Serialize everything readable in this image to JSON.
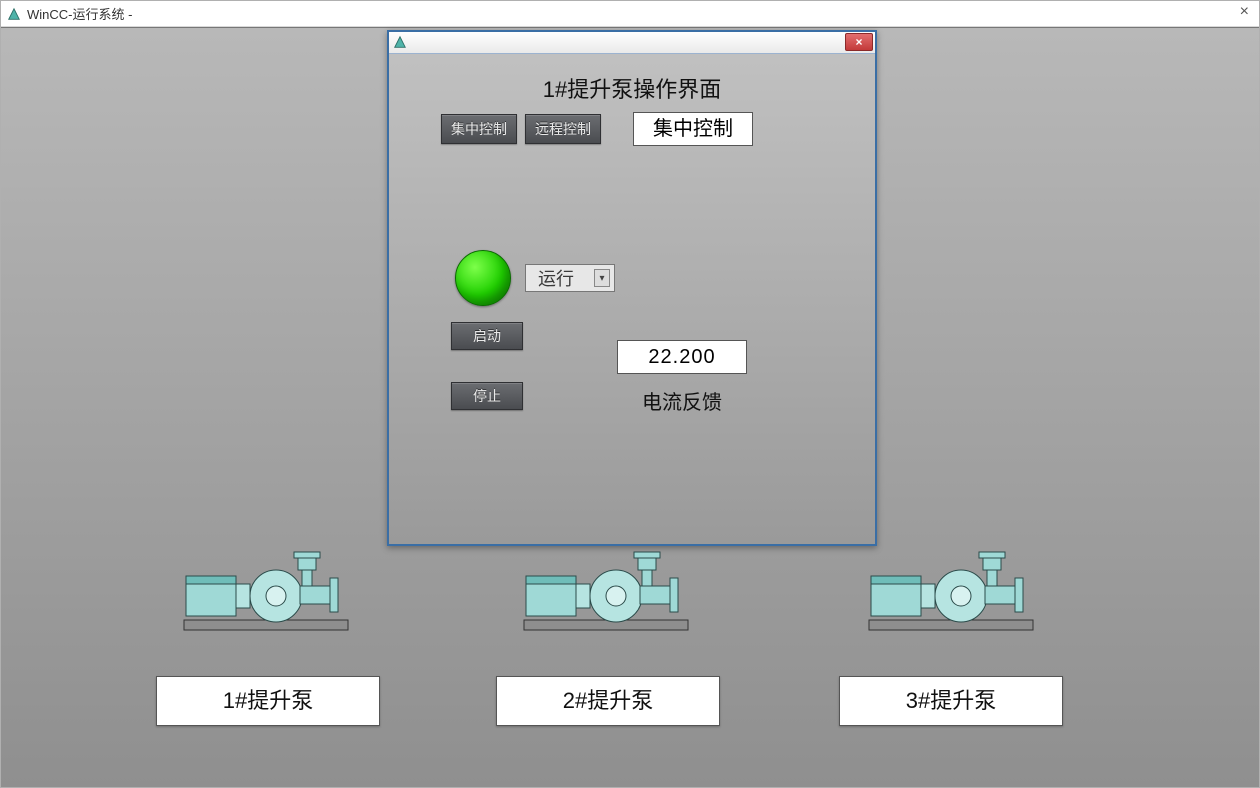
{
  "window": {
    "title": "WinCC-运行系统 -"
  },
  "dialog": {
    "title": "1#提升泵操作界面",
    "mode_btn_central": "集中控制",
    "mode_btn_remote": "远程控制",
    "mode_display": "集中控制",
    "run_select": "运行",
    "start_btn": "启动",
    "stop_btn": "停止",
    "current_value": "22.200",
    "current_label": "电流反馈",
    "status_color": "#1fcf00"
  },
  "pumps": {
    "p1": "1#提升泵",
    "p2": "2#提升泵",
    "p3": "3#提升泵"
  }
}
